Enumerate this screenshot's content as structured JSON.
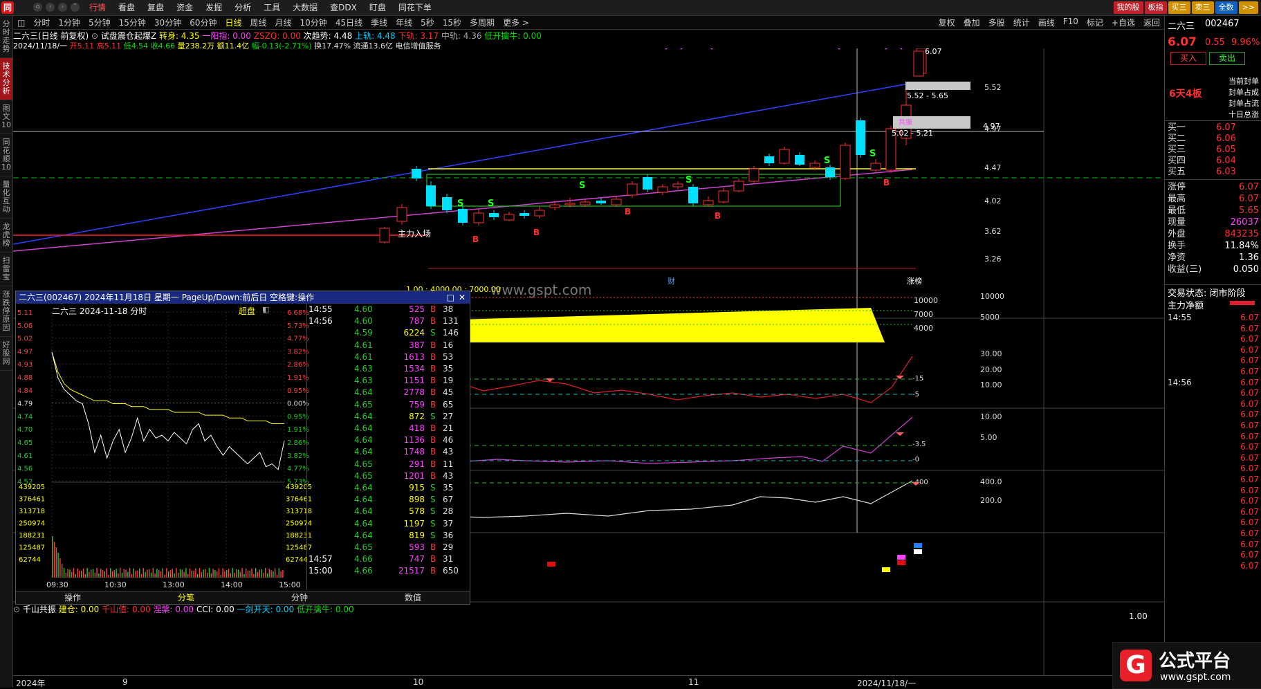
{
  "app": {
    "logo_letter": "同"
  },
  "menu": {
    "items": [
      "行情",
      "看盘",
      "复盘",
      "资金",
      "发掘",
      "分析",
      "工具",
      "大数据",
      "查DDX",
      "盯盘",
      "同花下单"
    ],
    "active": "行情"
  },
  "top_right": {
    "buttons": [
      {
        "label": "我的股",
        "color": "#c0202a"
      },
      {
        "label": "板指",
        "color": "#c0202a"
      },
      {
        "label": "买三",
        "color": "#d09000"
      },
      {
        "label": "卖三",
        "color": "#d09000"
      },
      {
        "label": "全数",
        "color": "#1060c0"
      },
      {
        "label": ">>",
        "color": "#d09000"
      }
    ]
  },
  "left_tabs": [
    {
      "label": "分时走势",
      "active": false
    },
    {
      "label": "技术分析",
      "active": true
    },
    {
      "label": "图文10",
      "active": false
    },
    {
      "label": "同花顺10",
      "active": false
    },
    {
      "label": "量化互动",
      "active": false
    },
    {
      "label": "龙虎榜",
      "active": false
    },
    {
      "label": "扫雷宝",
      "active": false
    },
    {
      "label": "涨跌停原因",
      "active": false
    },
    {
      "label": "好股网",
      "active": false
    }
  ],
  "toolbar": {
    "periods": [
      "分时",
      "1分钟",
      "5分钟",
      "15分钟",
      "30分钟",
      "60分钟",
      "日线",
      "周线",
      "月线",
      "10分钟",
      "45日线",
      "季线",
      "年线",
      "5秒",
      "15秒",
      "多周期",
      "更多 >"
    ],
    "active": "日线",
    "right": [
      "复权",
      "叠加",
      "多股",
      "统计",
      "画线",
      "F10",
      "标记",
      "+自选",
      "返回"
    ]
  },
  "indicator_line": {
    "name": "二六三(日线 前复权)",
    "formula": "试盘震仓起爆Z",
    "items": [
      {
        "text": "转身: 4.35",
        "color": "#ffff00"
      },
      {
        "text": "一阳指: 0.00",
        "color": "#ff40ff"
      },
      {
        "text": "ZSZQ: 0.00",
        "color": "#ff3030"
      },
      {
        "text": "次趋势: 4.48",
        "color": "#ffffff"
      },
      {
        "text": "上轨: 4.48",
        "color": "#00d0ff"
      },
      {
        "text": "下轨: 3.17",
        "color": "#ff3030"
      },
      {
        "text": "中轨: 4.36",
        "color": "#aaaaaa"
      },
      {
        "text": "低开擒牛: 0.00",
        "color": "#00e000"
      }
    ]
  },
  "quote_line": {
    "date": "2024/11/18/一",
    "items": [
      {
        "text": "开5.11",
        "color": "#ff3030"
      },
      {
        "text": "高5.11",
        "color": "#ff3030"
      },
      {
        "text": "低4.54",
        "color": "#00e000"
      },
      {
        "text": "收4.66",
        "color": "#00e000"
      },
      {
        "text": "量238.2万",
        "color": "#ffff00"
      },
      {
        "text": "额11.4亿",
        "color": "#ffff00"
      },
      {
        "text": "幅-0.13(-2.71%)",
        "color": "#00e000"
      },
      {
        "text": "换17.47%",
        "color": "#dddddd"
      },
      {
        "text": "流通13.6亿",
        "color": "#dddddd"
      },
      {
        "text": "电信增值服务",
        "color": "#dddddd"
      }
    ]
  },
  "main_chart": {
    "price_axis": [
      "5.52",
      "4.97",
      "4.47",
      "4.02",
      "3.62",
      "3.26"
    ],
    "annotations": {
      "high_label": "6.07",
      "zone1": "5.52 - 5.65",
      "zone2_title": "共振",
      "zone2": "5.02 - 5.21",
      "main_entry": "主力入场",
      "finance_marker": "财",
      "limit_marker": "涨榜",
      "crosshair_price": "4.97"
    },
    "vol_axis": [
      "10000",
      "5000"
    ],
    "vol_labels": [
      "10000",
      "7000",
      "4000"
    ],
    "vol_header": "1.00 : 4000.00 : 7000.00",
    "ind1_axis": [
      "30.00",
      "20.00",
      "10.00"
    ],
    "ind1_levels": [
      "-15",
      "-5"
    ],
    "ind2_axis": [
      "10.00",
      "5.00"
    ],
    "ind2_levels": [
      "-3.5",
      "-0"
    ],
    "ind3_axis": [
      "400.0",
      "200.0"
    ],
    "ind3_levels": [
      "-400"
    ],
    "watermark": "www.gspt.com"
  },
  "bottom_indicator": {
    "name": "千山共振",
    "items": [
      {
        "text": "建仓: 0.00",
        "color": "#ffff00"
      },
      {
        "text": "千山值: 0.00",
        "color": "#ff3030"
      },
      {
        "text": "涅槃: 0.00",
        "color": "#ff40ff"
      },
      {
        "text": "CCI: 0.00",
        "color": "#ffffff"
      },
      {
        "text": "一剑开天: 0.00",
        "color": "#00d0ff"
      },
      {
        "text": "低开擒牛: 0.00",
        "color": "#00e000"
      }
    ],
    "axis": "1.00"
  },
  "time_axis": [
    "2024年",
    "9",
    "10",
    "11",
    "2024/11/18/一"
  ],
  "right_panel": {
    "stock_name": "二六三",
    "stock_code": "002467",
    "price": "6.07",
    "change": "0.55",
    "pct": "9.96%",
    "buy_btn": "买入",
    "sell_btn": "卖出",
    "board_tag": "6天4板",
    "seal_labels": [
      "当前封单",
      "封单占成",
      "封单占流",
      "十日总涨"
    ],
    "bids": [
      {
        "k": "买一",
        "v": "6.07"
      },
      {
        "k": "买二",
        "v": "6.06"
      },
      {
        "k": "买三",
        "v": "6.05"
      },
      {
        "k": "买四",
        "v": "6.04"
      },
      {
        "k": "买五",
        "v": "6.03"
      }
    ],
    "stats": [
      {
        "k": "涨停",
        "v": "6.07",
        "color": "#ff3030"
      },
      {
        "k": "最高",
        "v": "6.07",
        "color": "#ff3030"
      },
      {
        "k": "最低",
        "v": "5.65",
        "color": "#ff3030"
      },
      {
        "k": "现量",
        "v": "26037",
        "color": "#ff40ff"
      },
      {
        "k": "外盘",
        "v": "843235",
        "color": "#ff3030"
      },
      {
        "k": "换手",
        "v": "11.84%",
        "color": "#ffffff"
      },
      {
        "k": "净资",
        "v": "1.36",
        "color": "#ffffff"
      },
      {
        "k": "收益(三)",
        "v": "0.050",
        "color": "#ffffff"
      }
    ],
    "trade_status": "交易状态: 闭市阶段",
    "net_label": "主力净额",
    "ticks": [
      {
        "t": "14:55",
        "p": "6.07"
      },
      {
        "t": "",
        "p": "6.07"
      },
      {
        "t": "",
        "p": "6.07"
      },
      {
        "t": "",
        "p": "6.07"
      },
      {
        "t": "",
        "p": "6.07"
      },
      {
        "t": "",
        "p": "6.07"
      },
      {
        "t": "14:56",
        "p": "6.07"
      },
      {
        "t": "",
        "p": "6.07"
      },
      {
        "t": "",
        "p": "6.07"
      },
      {
        "t": "",
        "p": "6.07"
      },
      {
        "t": "",
        "p": "6.07"
      },
      {
        "t": "",
        "p": "6.07"
      },
      {
        "t": "",
        "p": "6.07"
      },
      {
        "t": "",
        "p": "6.07"
      },
      {
        "t": "",
        "p": "6.07"
      },
      {
        "t": "",
        "p": "6.07"
      },
      {
        "t": "",
        "p": "6.07"
      },
      {
        "t": "",
        "p": "6.07"
      },
      {
        "t": "",
        "p": "6.07"
      },
      {
        "t": "",
        "p": "6.07"
      },
      {
        "t": "",
        "p": "6.07"
      },
      {
        "t": "",
        "p": "6.07"
      },
      {
        "t": "",
        "p": "6.07"
      },
      {
        "t": "",
        "p": "6.07"
      }
    ]
  },
  "popup": {
    "title": "二六三(002467) 2024年11月18日 星期一 PageUp/Down:前后日 空格键:操作",
    "subtitle": "二六三  2024-11-18 分时",
    "super_label": "超盘",
    "price_left": [
      "5.11",
      "5.06",
      "5.02",
      "4.97",
      "4.93",
      "4.88",
      "4.84",
      "4.79",
      "4.74",
      "4.70",
      "4.65",
      "4.61",
      "4.56",
      "4.52"
    ],
    "pct_right": [
      "6.68%",
      "5.73%",
      "4.77%",
      "3.82%",
      "2.86%",
      "1.91%",
      "0.95%",
      "0.00%",
      "0.95%",
      "1.91%",
      "2.86%",
      "3.82%",
      "4.77%",
      "5.73%"
    ],
    "vol_left": [
      "439205",
      "376461",
      "313718",
      "250974",
      "188231",
      "125487",
      "62744"
    ],
    "time_axis": [
      "09:30",
      "10:30",
      "13:00",
      "14:00",
      "15:00"
    ],
    "tabs": [
      "操作",
      "分笔",
      "分钟",
      "数值"
    ],
    "active_tab": "分笔",
    "price_series": [
      4.97,
      4.88,
      4.84,
      4.82,
      4.8,
      4.79,
      4.72,
      4.62,
      4.68,
      4.6,
      4.66,
      4.7,
      4.62,
      4.67,
      4.74,
      4.66,
      4.7,
      4.67,
      4.68,
      4.66,
      4.69,
      4.67,
      4.65,
      4.7,
      4.72,
      4.66,
      4.68,
      4.64,
      4.61,
      4.64,
      4.62,
      4.6,
      4.58,
      4.6,
      4.62,
      4.57,
      4.58,
      4.56,
      4.66
    ],
    "avg_series": [
      4.97,
      4.9,
      4.86,
      4.84,
      4.83,
      4.82,
      4.81,
      4.8,
      4.8,
      4.8,
      4.79,
      4.79,
      4.79,
      4.78,
      4.78,
      4.78,
      4.77,
      4.77,
      4.77,
      4.77,
      4.76,
      4.76,
      4.76,
      4.76,
      4.76,
      4.75,
      4.75,
      4.75,
      4.75,
      4.74,
      4.74,
      4.74,
      4.73,
      4.73,
      4.73,
      4.73,
      4.72,
      4.72,
      4.72
    ],
    "ticks": [
      {
        "t": "14:55",
        "p": "4.60",
        "v": "525",
        "bs": "B",
        "n": "38"
      },
      {
        "t": "14:56",
        "p": "4.60",
        "v": "787",
        "bs": "B",
        "n": "131"
      },
      {
        "t": "",
        "p": "4.59",
        "v": "6224",
        "bs": "S",
        "n": "146"
      },
      {
        "t": "",
        "p": "4.61",
        "v": "387",
        "bs": "B",
        "n": "16"
      },
      {
        "t": "",
        "p": "4.61",
        "v": "1613",
        "bs": "B",
        "n": "53"
      },
      {
        "t": "",
        "p": "4.63",
        "v": "1534",
        "bs": "B",
        "n": "35"
      },
      {
        "t": "",
        "p": "4.63",
        "v": "1151",
        "bs": "B",
        "n": "19"
      },
      {
        "t": "",
        "p": "4.64",
        "v": "2778",
        "bs": "B",
        "n": "45"
      },
      {
        "t": "",
        "p": "4.65",
        "v": "759",
        "bs": "B",
        "n": "65"
      },
      {
        "t": "",
        "p": "4.64",
        "v": "872",
        "bs": "S",
        "n": "27"
      },
      {
        "t": "",
        "p": "4.64",
        "v": "418",
        "bs": "B",
        "n": "21"
      },
      {
        "t": "",
        "p": "4.64",
        "v": "1136",
        "bs": "B",
        "n": "46"
      },
      {
        "t": "",
        "p": "4.64",
        "v": "1748",
        "bs": "B",
        "n": "43"
      },
      {
        "t": "",
        "p": "4.65",
        "v": "291",
        "bs": "B",
        "n": "11"
      },
      {
        "t": "",
        "p": "4.65",
        "v": "1201",
        "bs": "B",
        "n": "43"
      },
      {
        "t": "",
        "p": "4.64",
        "v": "915",
        "bs": "S",
        "n": "35"
      },
      {
        "t": "",
        "p": "4.64",
        "v": "898",
        "bs": "S",
        "n": "67"
      },
      {
        "t": "",
        "p": "4.64",
        "v": "578",
        "bs": "S",
        "n": "28"
      },
      {
        "t": "",
        "p": "4.64",
        "v": "1197",
        "bs": "S",
        "n": "37"
      },
      {
        "t": "",
        "p": "4.64",
        "v": "819",
        "bs": "S",
        "n": "36"
      },
      {
        "t": "",
        "p": "4.65",
        "v": "593",
        "bs": "B",
        "n": "29"
      },
      {
        "t": "14:57",
        "p": "4.66",
        "v": "747",
        "bs": "B",
        "n": "31"
      },
      {
        "t": "15:00",
        "p": "4.66",
        "v": "21517",
        "bs": "B",
        "n": "650"
      }
    ]
  },
  "brand": {
    "name": "公式平台",
    "url": "www.gspt.com"
  }
}
